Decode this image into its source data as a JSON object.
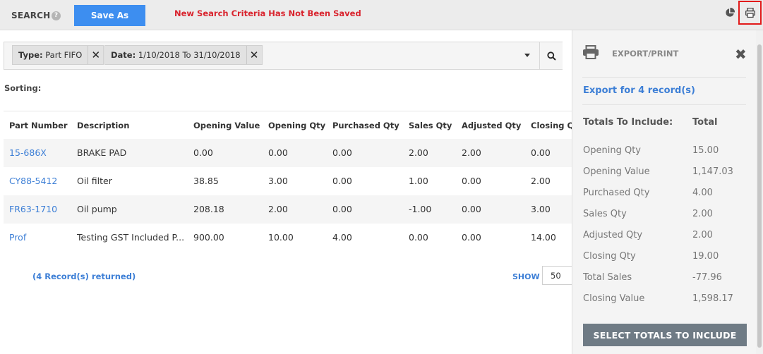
{
  "header": {
    "search_label": "SEARCH",
    "help_icon": "?",
    "save_as_label": "Save As",
    "unsaved_message": "New Search Criteria Has Not Been Saved"
  },
  "filters": {
    "chips": [
      {
        "key": "Type:",
        "value": "Part FIFO"
      },
      {
        "key": "Date:",
        "value": "1/10/2018 To 31/10/2018"
      }
    ],
    "remove_glyph": "✕"
  },
  "sorting_label": "Sorting:",
  "table": {
    "columns": [
      "Part Number",
      "Description",
      "Opening Value",
      "Opening Qty",
      "Purchased Qty",
      "Sales Qty",
      "Adjusted Qty",
      "Closing Qty"
    ],
    "rows": [
      [
        "15-686X",
        "BRAKE PAD",
        "0.00",
        "0.00",
        "0.00",
        "2.00",
        "2.00",
        "0.00"
      ],
      [
        "CY88-5412",
        "Oil filter",
        "38.85",
        "3.00",
        "0.00",
        "1.00",
        "0.00",
        "2.00"
      ],
      [
        "FR63-1710",
        "Oil pump",
        "208.18",
        "2.00",
        "0.00",
        "-1.00",
        "0.00",
        "3.00"
      ],
      [
        "Prof",
        "Testing GST Included P...",
        "900.00",
        "10.00",
        "4.00",
        "0.00",
        "0.00",
        "14.00"
      ]
    ]
  },
  "footer": {
    "records_returned": "(4 Record(s) returned)",
    "show_label": "SHOW",
    "page_size": "50"
  },
  "panel": {
    "title": "EXPORT/PRINT",
    "close_glyph": "✖",
    "export_link": "Export for 4 record(s)",
    "totals_heading": "Totals To Include:",
    "total_heading": "Total",
    "totals": [
      {
        "label": "Opening Qty",
        "value": "15.00"
      },
      {
        "label": "Opening Value",
        "value": "1,147.03"
      },
      {
        "label": "Purchased Qty",
        "value": "4.00"
      },
      {
        "label": "Sales Qty",
        "value": "2.00"
      },
      {
        "label": "Adjusted Qty",
        "value": "2.00"
      },
      {
        "label": "Closing Qty",
        "value": "19.00"
      },
      {
        "label": "Total Sales",
        "value": "-77.96"
      },
      {
        "label": "Closing Value",
        "value": "1,598.17"
      }
    ],
    "select_button": "SELECT TOTALS TO INCLUDE"
  },
  "icons": {
    "help": "help-icon",
    "pie": "pie-chart-icon",
    "print": "printer-icon",
    "search": "search-icon",
    "close": "close-icon"
  },
  "colors": {
    "accent": "#3d8ef0",
    "link": "#3d7fd6",
    "warning": "#d9232d",
    "highlight_border": "#e21b1b",
    "panel_button": "#6f7b85"
  }
}
